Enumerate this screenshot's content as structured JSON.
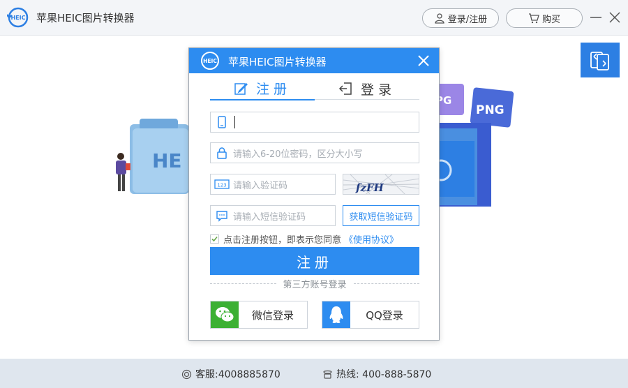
{
  "app": {
    "title": "苹果HEIC图片转换器",
    "logo_text": "HEIC",
    "login_register_label": "登录/注册",
    "buy_label": "购买"
  },
  "illustration": {
    "heic_label": "HE",
    "png_label": "PNG",
    "jpg_label": "PG"
  },
  "footer": {
    "service": "客服:4008885870",
    "hotline": "热线: 400-888-5870"
  },
  "dialog": {
    "title": "苹果HEIC图片转换器",
    "tabs": [
      {
        "label": "注册",
        "active": true
      },
      {
        "label": "登录",
        "active": false
      }
    ],
    "phone_value": "",
    "password_placeholder": "请输入6-20位密码，区分大小写",
    "captcha_placeholder": "请输入验证码",
    "captcha_text": "fzFH",
    "sms_placeholder": "请输入短信验证码",
    "get_sms_label": "获取短信验证码",
    "agree_text": "点击注册按钮，即表示您同意",
    "agree_link": "《使用协议》",
    "agree_checked": true,
    "submit_label": "注册",
    "third_party_label": "第三方账号登录",
    "wechat_label": "微信登录",
    "qq_label": "QQ登录"
  },
  "colors": {
    "accent": "#2d8cf0",
    "wechat": "#3cb034",
    "footer_bg": "#dfe6ee"
  }
}
